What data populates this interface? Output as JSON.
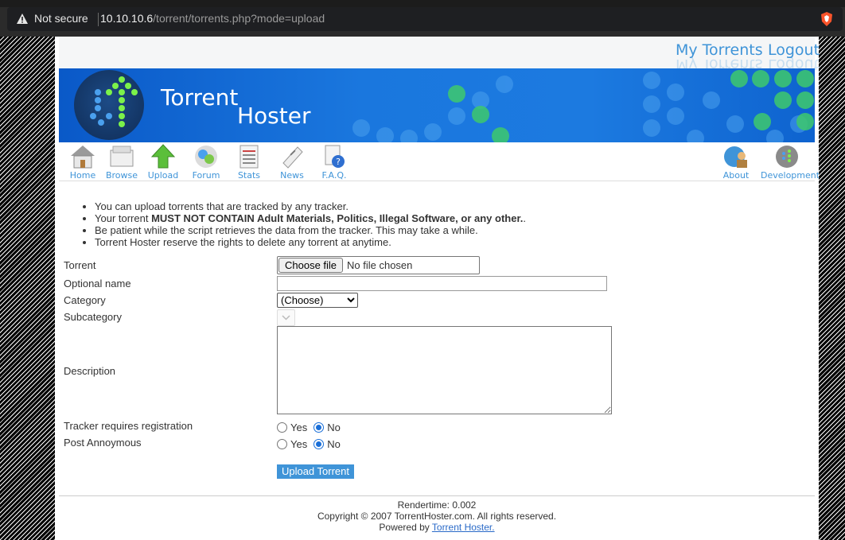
{
  "browser": {
    "security_label": "Not secure",
    "url_host": "10.10.10.6",
    "url_path": "/torrent/torrents.php?mode=upload"
  },
  "topbar": {
    "my_torrents": "My Torrents",
    "logout": "Logout"
  },
  "banner": {
    "title_line1": "Torrent",
    "title_line2": "Hoster"
  },
  "nav": {
    "items": [
      {
        "label": "Home",
        "icon": "home-icon"
      },
      {
        "label": "Browse",
        "icon": "browse-icon"
      },
      {
        "label": "Upload",
        "icon": "upload-icon"
      },
      {
        "label": "Forum",
        "icon": "forum-icon"
      },
      {
        "label": "Stats",
        "icon": "stats-icon"
      },
      {
        "label": "News",
        "icon": "news-icon"
      },
      {
        "label": "F.A.Q.",
        "icon": "faq-icon"
      }
    ],
    "right_items": [
      {
        "label": "About",
        "icon": "about-icon"
      },
      {
        "label": "Development",
        "icon": "development-icon"
      }
    ]
  },
  "rules": {
    "r1": "You can upload torrents that are tracked by any tracker.",
    "r2_pre": "Your torrent ",
    "r2_bold": "MUST NOT CONTAIN Adult Materials, Politics, Illegal Software, or any other.",
    "r2_post": ".",
    "r3": "Be patient while the script retrieves the data from the tracker. This may take a while.",
    "r4": "Torrent Hoster reserve the rights to delete any torrent at anytime."
  },
  "form": {
    "torrent_label": "Torrent",
    "choose_file": "Choose file",
    "no_file": "No file chosen",
    "optional_name_label": "Optional name",
    "optional_name_value": "",
    "category_label": "Category",
    "category_value": "(Choose)",
    "subcategory_label": "Subcategory",
    "description_label": "Description",
    "description_value": "",
    "tracker_reg_label": "Tracker requires registration",
    "post_anon_label": "Post Annoymous",
    "yes": "Yes",
    "no": "No",
    "tracker_reg_selected": "No",
    "post_anon_selected": "No",
    "submit": "Upload Torrent"
  },
  "footer": {
    "rendertime": "Rendertime: 0.002",
    "copyright": "Copyright © 2007 TorrentHoster.com. All rights reserved.",
    "powered_prefix": "Powered by ",
    "powered_link": "Torrent Hoster."
  },
  "colors": {
    "accent": "#3f94d8",
    "banner_blue": "#1a77de"
  }
}
